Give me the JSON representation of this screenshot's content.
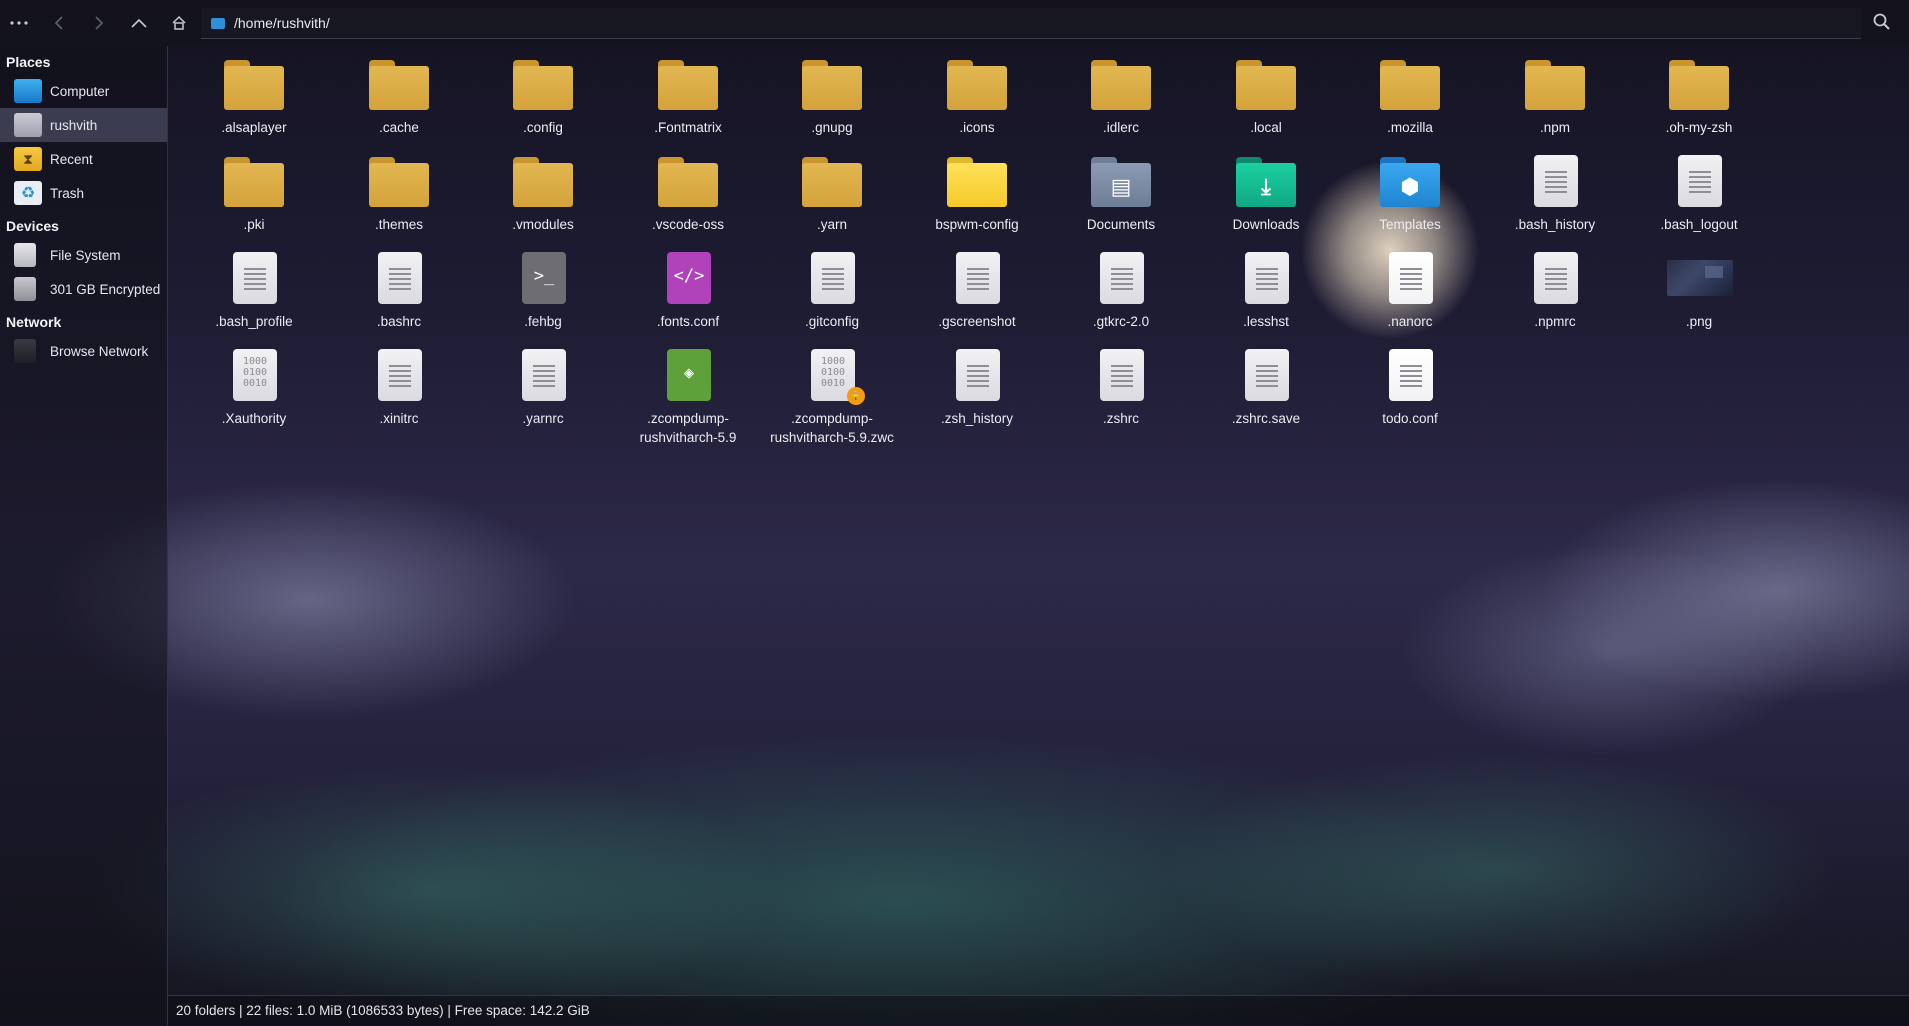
{
  "toolbar": {
    "menu_icon": "more-horizontal-icon",
    "back_icon": "chevron-left-icon",
    "forward_icon": "chevron-right-icon",
    "up_icon": "chevron-up-icon",
    "home_icon": "home-icon",
    "address": "/home/rushvith/",
    "search_icon": "search-icon"
  },
  "sidebar": {
    "sections": [
      {
        "title": "Places",
        "items": [
          {
            "label": "Computer",
            "icon": "computer-icon",
            "active": false
          },
          {
            "label": "rushvith",
            "icon": "home-folder-icon",
            "active": true
          },
          {
            "label": "Recent",
            "icon": "recent-icon",
            "active": false
          },
          {
            "label": "Trash",
            "icon": "trash-icon",
            "active": false
          }
        ]
      },
      {
        "title": "Devices",
        "items": [
          {
            "label": "File System",
            "icon": "drive-icon",
            "active": false
          },
          {
            "label": "301 GB Encrypted",
            "icon": "encrypted-drive-icon",
            "active": false
          }
        ]
      },
      {
        "title": "Network",
        "items": [
          {
            "label": "Browse Network",
            "icon": "network-icon",
            "active": false
          }
        ]
      }
    ]
  },
  "files": [
    {
      "name": ".alsaplayer",
      "type": "folder"
    },
    {
      "name": ".cache",
      "type": "folder"
    },
    {
      "name": ".config",
      "type": "folder"
    },
    {
      "name": ".Fontmatrix",
      "type": "folder"
    },
    {
      "name": ".gnupg",
      "type": "folder"
    },
    {
      "name": ".icons",
      "type": "folder"
    },
    {
      "name": ".idlerc",
      "type": "folder"
    },
    {
      "name": ".local",
      "type": "folder"
    },
    {
      "name": ".mozilla",
      "type": "folder"
    },
    {
      "name": ".npm",
      "type": "folder"
    },
    {
      "name": ".oh-my-zsh",
      "type": "folder"
    },
    {
      "name": ".pki",
      "type": "folder"
    },
    {
      "name": ".themes",
      "type": "folder"
    },
    {
      "name": ".vmodules",
      "type": "folder"
    },
    {
      "name": ".vscode-oss",
      "type": "folder"
    },
    {
      "name": ".yarn",
      "type": "folder"
    },
    {
      "name": "bspwm-config",
      "type": "folder-bright"
    },
    {
      "name": "Documents",
      "type": "folder-docs"
    },
    {
      "name": "Downloads",
      "type": "folder-downloads"
    },
    {
      "name": "Templates",
      "type": "folder-templates"
    },
    {
      "name": ".bash_history",
      "type": "text"
    },
    {
      "name": ".bash_logout",
      "type": "text"
    },
    {
      "name": ".bash_profile",
      "type": "text"
    },
    {
      "name": ".bashrc",
      "type": "text"
    },
    {
      "name": ".fehbg",
      "type": "script"
    },
    {
      "name": ".fonts.conf",
      "type": "xml"
    },
    {
      "name": ".gitconfig",
      "type": "text"
    },
    {
      "name": ".gscreenshot",
      "type": "text"
    },
    {
      "name": ".gtkrc-2.0",
      "type": "text"
    },
    {
      "name": ".lesshst",
      "type": "text"
    },
    {
      "name": ".nanorc",
      "type": "text-white"
    },
    {
      "name": ".npmrc",
      "type": "text"
    },
    {
      "name": ".png",
      "type": "image"
    },
    {
      "name": ".Xauthority",
      "type": "binary"
    },
    {
      "name": ".xinitrc",
      "type": "text"
    },
    {
      "name": ".yarnrc",
      "type": "text"
    },
    {
      "name": ".zcompdump-rushvitharch-5.9",
      "type": "epub"
    },
    {
      "name": ".zcompdump-rushvitharch-5.9.zwc",
      "type": "binary-locked"
    },
    {
      "name": ".zsh_history",
      "type": "text"
    },
    {
      "name": ".zshrc",
      "type": "text"
    },
    {
      "name": ".zshrc.save",
      "type": "text"
    },
    {
      "name": "todo.conf",
      "type": "text-white"
    }
  ],
  "status": {
    "text": "20 folders  |  22 files: 1.0 MiB (1086533 bytes)  |  Free space: 142.2 GiB"
  },
  "colors": {
    "folder": "#d9a93f",
    "accent_downloads": "#14b890",
    "accent_templates": "#2a96e0",
    "selection": "#5c5e78"
  }
}
